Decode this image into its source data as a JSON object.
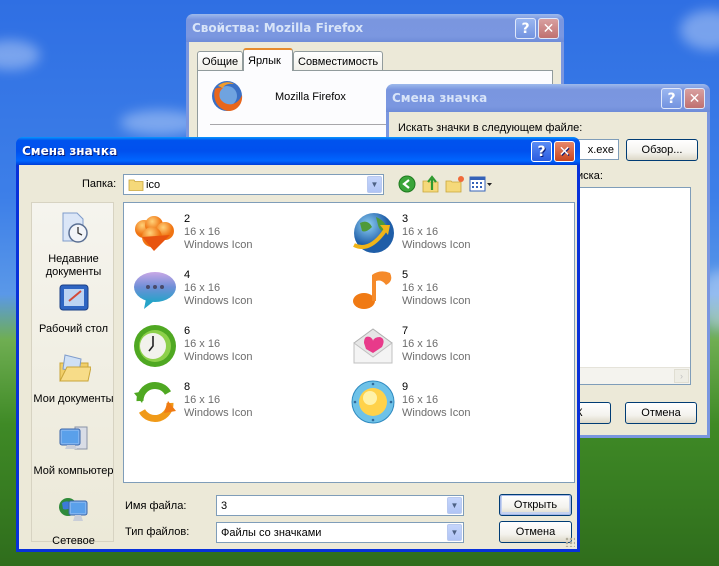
{
  "desktop": {
    "wallpaper": "bliss"
  },
  "properties_window": {
    "title": "Свойства: Mozilla Firefox",
    "tabs": [
      {
        "label": "Общие",
        "selected": false
      },
      {
        "label": "Ярлык",
        "selected": true
      },
      {
        "label": "Совместимость",
        "selected": false
      }
    ],
    "app_name": "Mozilla Firefox",
    "app_icon": "firefox-icon"
  },
  "change_icon_back": {
    "title": "Смена значка",
    "search_label": "Искать значки в следующем файле:",
    "file_value_visible": "x.exe",
    "browse_label": "Обзор...",
    "select_label_visible": "иска:",
    "ok_label": "ОК",
    "cancel_label": "Отмена"
  },
  "change_icon_dialog": {
    "title": "Смена значка",
    "folder_label": "Папка:",
    "folder_value": "ico",
    "toolbar": {
      "back": "back-icon",
      "up": "folder-up-icon",
      "new_folder": "new-folder-icon",
      "view": "view-menu-icon"
    },
    "places": [
      {
        "label": "Недавние документы",
        "icon": "recent-documents-icon"
      },
      {
        "label": "Рабочий стол",
        "icon": "desktop-icon"
      },
      {
        "label": "Мои документы",
        "icon": "my-documents-icon"
      },
      {
        "label": "Мой компьютер",
        "icon": "my-computer-icon"
      },
      {
        "label": "Сетевое",
        "icon": "network-icon"
      }
    ],
    "files": [
      {
        "name": "2",
        "dims": "16 x 16",
        "type": "Windows Icon",
        "icon": "hearts-icon"
      },
      {
        "name": "3",
        "dims": "16 x 16",
        "type": "Windows Icon",
        "icon": "globe-arrow-icon"
      },
      {
        "name": "4",
        "dims": "16 x 16",
        "type": "Windows Icon",
        "icon": "chat-bubble-icon"
      },
      {
        "name": "5",
        "dims": "16 x 16",
        "type": "Windows Icon",
        "icon": "music-note-icon"
      },
      {
        "name": "6",
        "dims": "16 x 16",
        "type": "Windows Icon",
        "icon": "clock-icon"
      },
      {
        "name": "7",
        "dims": "16 x 16",
        "type": "Windows Icon",
        "icon": "love-letter-icon"
      },
      {
        "name": "8",
        "dims": "16 x 16",
        "type": "Windows Icon",
        "icon": "refresh-icon"
      },
      {
        "name": "9",
        "dims": "16 x 16",
        "type": "Windows Icon",
        "icon": "porthole-icon"
      }
    ],
    "filename_label": "Имя файла:",
    "filename_value": "3",
    "filetype_label": "Тип файлов:",
    "filetype_value": "Файлы со значками",
    "open_label": "Открыть",
    "cancel_label": "Отмена"
  }
}
